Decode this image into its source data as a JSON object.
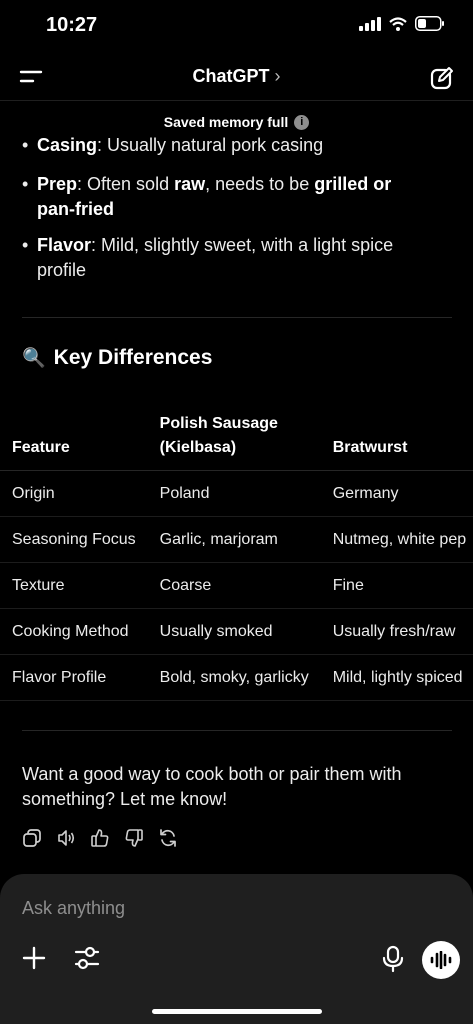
{
  "status": {
    "time": "10:27"
  },
  "header": {
    "title": "ChatGPT",
    "chevron": "›",
    "menu_icon": "menu-icon",
    "edit_icon": "new-chat-icon"
  },
  "banner": {
    "text": "Saved memory full",
    "info_icon": "i"
  },
  "bullets": [
    {
      "label": "Casing",
      "text": ": Usually natural pork casing"
    },
    {
      "label": "Prep",
      "text_a": ": Often sold ",
      "bold_a": "raw",
      "text_b": ", needs to be ",
      "bold_b": "grilled or pan-fried"
    },
    {
      "label": "Flavor",
      "text": ": Mild, slightly sweet, with a light spice profile"
    }
  ],
  "section": {
    "emoji": "🔍",
    "title": "Key Differences"
  },
  "table": {
    "headers": [
      "Feature",
      "Polish Sausage (Kielbasa)",
      "Bratwurst"
    ],
    "rows": [
      [
        "Origin",
        "Poland",
        "Germany"
      ],
      [
        "Seasoning Focus",
        "Garlic, marjoram",
        "Nutmeg, white pep"
      ],
      [
        "Texture",
        "Coarse",
        "Fine"
      ],
      [
        "Cooking Method",
        "Usually smoked",
        "Usually fresh/raw"
      ],
      [
        "Flavor Profile",
        "Bold, smoky, garlicky",
        "Mild, lightly spiced"
      ]
    ]
  },
  "closing": "Want a good way to cook both or pair them with something? Let me know!",
  "composer": {
    "placeholder": "Ask anything"
  },
  "colors": {
    "background": "#000000",
    "composer": "#1f1f1f",
    "text": "#ececec",
    "muted": "#8e8e8e"
  }
}
